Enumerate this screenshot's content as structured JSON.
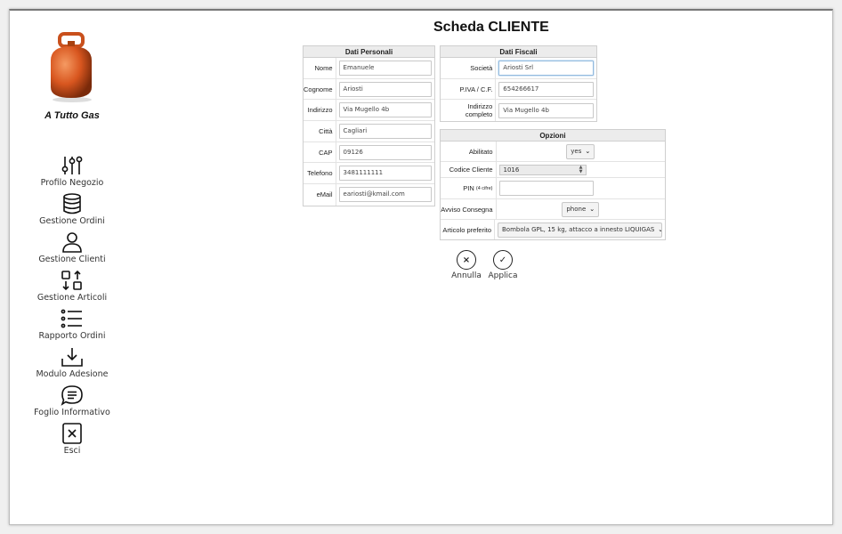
{
  "brand": {
    "name": "A Tutto Gas"
  },
  "sidebar": {
    "items": [
      {
        "label": "Profilo Negozio",
        "icon": "sliders-icon"
      },
      {
        "label": "Gestione Ordini",
        "icon": "database-icon"
      },
      {
        "label": "Gestione Clienti",
        "icon": "user-icon"
      },
      {
        "label": "Gestione Articoli",
        "icon": "arrange-icon"
      },
      {
        "label": "Rapporto Ordini",
        "icon": "list-icon"
      },
      {
        "label": "Modulo Adesione",
        "icon": "download-icon"
      },
      {
        "label": "Foglio Informativo",
        "icon": "chat-icon"
      },
      {
        "label": "Esci",
        "icon": "close-square-icon"
      }
    ]
  },
  "page": {
    "title": "Scheda CLIENTE"
  },
  "personal": {
    "header": "Dati Personali",
    "fields": [
      {
        "label": "Nome",
        "value": "Emanuele"
      },
      {
        "label": "Cognome",
        "value": "Ariosti"
      },
      {
        "label": "Indirizzo",
        "value": "Via Mugello 4b"
      },
      {
        "label": "Città",
        "value": "Cagliari"
      },
      {
        "label": "CAP",
        "value": "09126"
      },
      {
        "label": "Telefono",
        "value": "3481111111"
      },
      {
        "label": "eMail",
        "value": "eariosti@kmail.com"
      }
    ]
  },
  "fiscal": {
    "header": "Dati Fiscali",
    "fields": [
      {
        "label": "Società",
        "value": "Ariosti Srl"
      },
      {
        "label": "P.IVA / C.F.",
        "value": "654266617"
      },
      {
        "label": "Indirizzo completo",
        "value": "Via Mugello 4b"
      }
    ]
  },
  "options": {
    "header": "Opzioni",
    "abilitato": {
      "label": "Abilitato",
      "value": "yes"
    },
    "codice": {
      "label": "Codice Cliente",
      "value": "1016"
    },
    "pin": {
      "label": "PIN",
      "sub": "(4 cifre)",
      "value": ""
    },
    "avviso": {
      "label": "Avviso Consegna",
      "value": "phone"
    },
    "articolo": {
      "label": "Articolo preferito",
      "value": "Bombola GPL, 15 kg, attacco a innesto LIQUIGAS"
    }
  },
  "actions": {
    "cancel": "Annulla",
    "apply": "Applica"
  },
  "colors": {
    "cylinder": "#e0602a",
    "focus": "#8fb8dd"
  }
}
